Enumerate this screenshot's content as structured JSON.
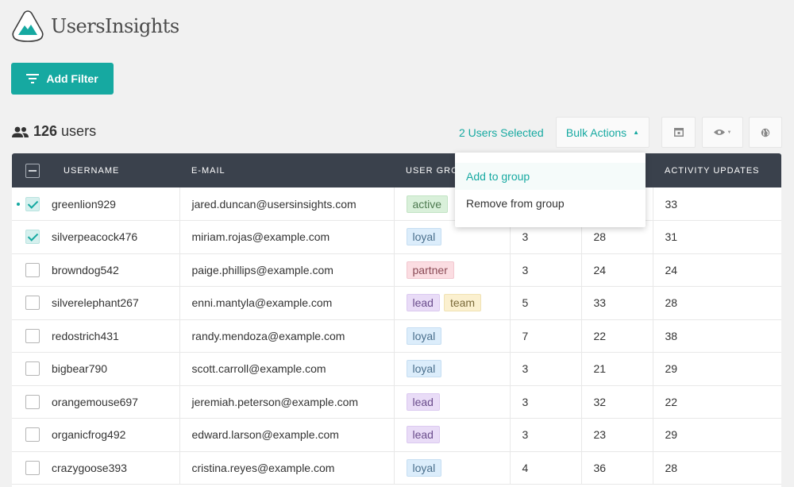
{
  "app": {
    "name": "UsersInsights"
  },
  "toolbar": {
    "add_filter_label": "Add Filter",
    "users_count": "126",
    "users_label": "users",
    "selected_text": "2 Users Selected",
    "bulk_actions_label": "Bulk Actions"
  },
  "bulk_menu": {
    "items": [
      "Add to group",
      "Remove from group"
    ]
  },
  "table": {
    "columns": [
      "USERNAME",
      "E-MAIL",
      "USER GROUPS",
      "",
      "",
      "ACTIVITY UPDATES"
    ],
    "rows": [
      {
        "username": "greenlion929",
        "email": "jared.duncan@usersinsights.com",
        "groups": [
          "active"
        ],
        "c1": "",
        "c2": "",
        "activity": "33",
        "checked": true,
        "current": true
      },
      {
        "username": "silverpeacock476",
        "email": "miriam.rojas@example.com",
        "groups": [
          "loyal"
        ],
        "c1": "3",
        "c2": "28",
        "activity": "31",
        "checked": true
      },
      {
        "username": "browndog542",
        "email": "paige.phillips@example.com",
        "groups": [
          "partner"
        ],
        "c1": "3",
        "c2": "24",
        "activity": "24",
        "checked": false
      },
      {
        "username": "silverelephant267",
        "email": "enni.mantyla@example.com",
        "groups": [
          "lead",
          "team"
        ],
        "c1": "5",
        "c2": "33",
        "activity": "28",
        "checked": false
      },
      {
        "username": "redostrich431",
        "email": "randy.mendoza@example.com",
        "groups": [
          "loyal"
        ],
        "c1": "7",
        "c2": "22",
        "activity": "38",
        "checked": false
      },
      {
        "username": "bigbear790",
        "email": "scott.carroll@example.com",
        "groups": [
          "loyal"
        ],
        "c1": "3",
        "c2": "21",
        "activity": "29",
        "checked": false
      },
      {
        "username": "orangemouse697",
        "email": "jeremiah.peterson@example.com",
        "groups": [
          "lead"
        ],
        "c1": "3",
        "c2": "32",
        "activity": "22",
        "checked": false
      },
      {
        "username": "organicfrog492",
        "email": "edward.larson@example.com",
        "groups": [
          "lead"
        ],
        "c1": "3",
        "c2": "23",
        "activity": "29",
        "checked": false
      },
      {
        "username": "crazygoose393",
        "email": "cristina.reyes@example.com",
        "groups": [
          "loyal"
        ],
        "c1": "4",
        "c2": "36",
        "activity": "28",
        "checked": false
      }
    ]
  },
  "tag_colors": {
    "active": {
      "bg": "#d9f0da",
      "fg": "#4e7a50",
      "border": "#c2e3c4"
    },
    "loyal": {
      "bg": "#dcedfb",
      "fg": "#4a6f8c",
      "border": "#c6def2"
    },
    "partner": {
      "bg": "#fbdde2",
      "fg": "#8a4a55",
      "border": "#f2c7cf"
    },
    "lead": {
      "bg": "#e9dcf7",
      "fg": "#6a4d8c",
      "border": "#dbc9f0"
    },
    "team": {
      "bg": "#fbf0cf",
      "fg": "#7a6a3a",
      "border": "#f0e2b3"
    }
  },
  "colors": {
    "accent": "#16a9a1",
    "header_bg": "#3a414c"
  }
}
